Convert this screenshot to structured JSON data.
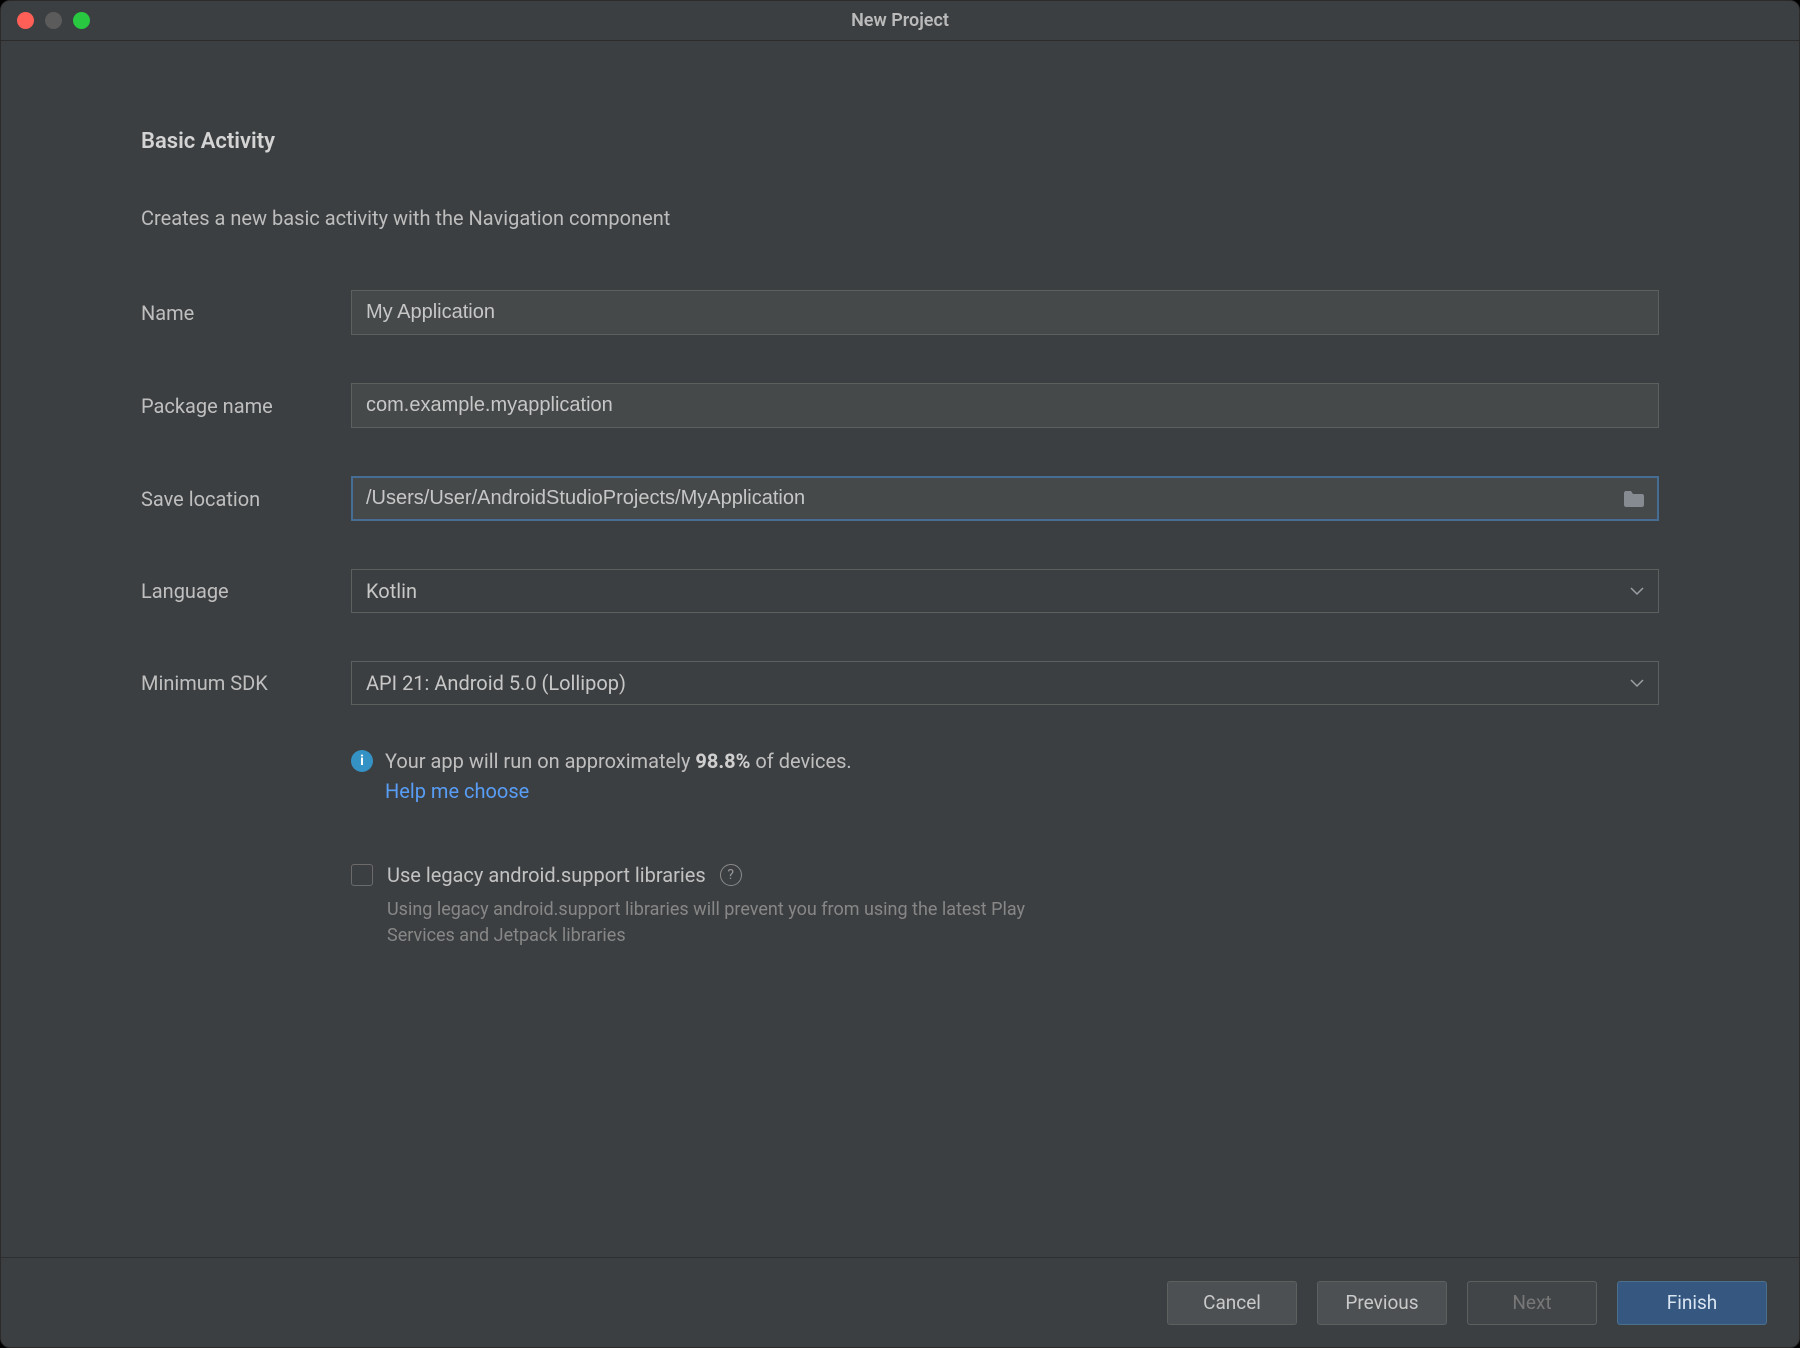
{
  "window": {
    "title": "New Project"
  },
  "header": {
    "heading": "Basic Activity",
    "subheading": "Creates a new basic activity with the Navigation component"
  },
  "form": {
    "name": {
      "label": "Name",
      "value": "My Application"
    },
    "package": {
      "label": "Package name",
      "value": "com.example.myapplication"
    },
    "location": {
      "label": "Save location",
      "value": "/Users/User/AndroidStudioProjects/MyApplication"
    },
    "language": {
      "label": "Language",
      "value": "Kotlin"
    },
    "min_sdk": {
      "label": "Minimum SDK",
      "value": "API 21: Android 5.0 (Lollipop)"
    }
  },
  "info": {
    "text_pre": "Your app will run on approximately ",
    "percent": "98.8%",
    "text_post": " of devices.",
    "help": "Help me choose"
  },
  "legacy": {
    "label": "Use legacy android.support libraries",
    "note": "Using legacy android.support libraries will prevent you from using the latest Play Services and Jetpack libraries",
    "checked": false
  },
  "footer": {
    "cancel": "Cancel",
    "previous": "Previous",
    "next": "Next",
    "finish": "Finish"
  }
}
